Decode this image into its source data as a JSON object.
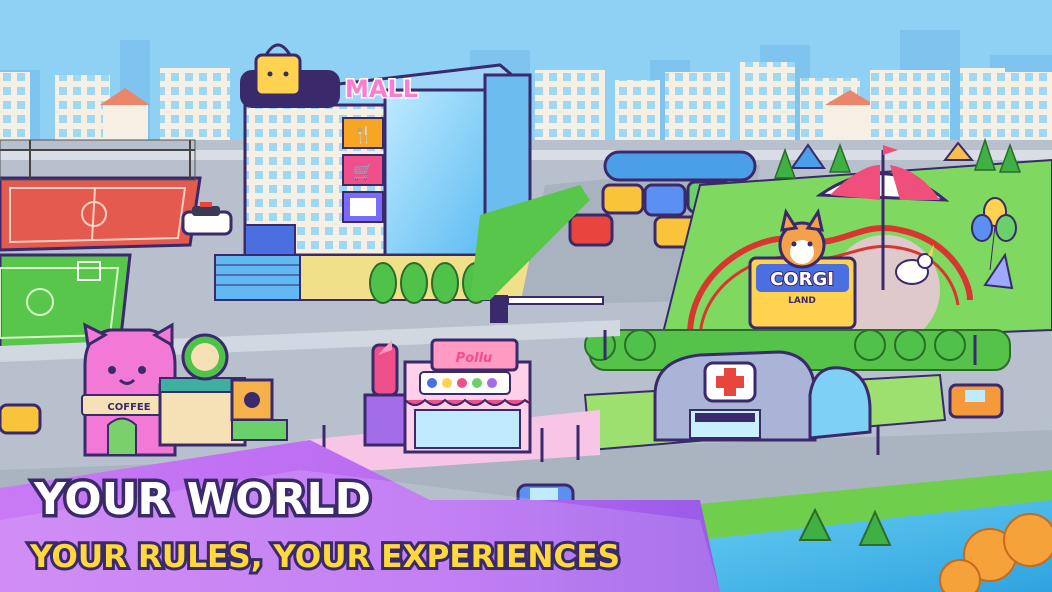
{
  "headline": {
    "line1": "YOUR WORLD",
    "line2": "YOUR RULES, YOUR EXPERIENCES"
  },
  "signs": {
    "mall": "MALL",
    "coffee": "COFFEE",
    "corgi": "CORGI",
    "land": "LAND",
    "shop": "Pollu"
  },
  "colors": {
    "sky": "#8fd0f5",
    "road": "#b7c0cc",
    "grass": "#6fcf4d",
    "headline_fill": "#ffffff",
    "subline_fill": "#ffd83b",
    "banner": "#b96bf2",
    "outline": "#3a2a6b"
  },
  "icons": [
    "shopping-bag-icon",
    "fork-knife-icon",
    "cart-icon",
    "cross-icon",
    "unicorn-icon",
    "balloon-icon"
  ]
}
